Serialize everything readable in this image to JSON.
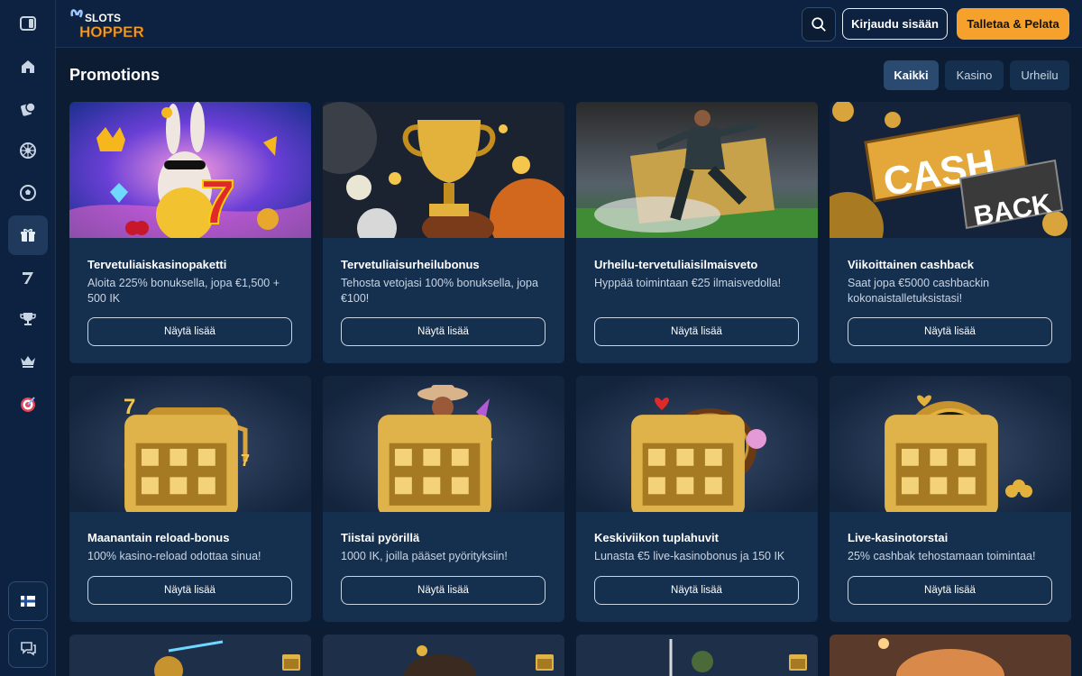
{
  "header": {
    "logo_top": "SLOTS",
    "logo_bottom": "HOPPER",
    "login_label": "Kirjaudu sisään",
    "deposit_label": "Talletaa & Pelata"
  },
  "page": {
    "title": "Promotions"
  },
  "filters": [
    {
      "label": "Kaikki",
      "active": true
    },
    {
      "label": "Kasino",
      "active": false
    },
    {
      "label": "Urheilu",
      "active": false
    }
  ],
  "sidebar": {
    "icons": [
      "toggle-sidebar-icon",
      "home-icon",
      "casino-chip-icon",
      "roulette-icon",
      "sports-ball-icon",
      "gift-icon",
      "lucky-seven-icon",
      "trophy-icon",
      "crown-icon",
      "target-icon"
    ],
    "active": "gift-icon",
    "bottom": [
      "finland-flag-icon",
      "chat-icon"
    ]
  },
  "cards": [
    {
      "title": "Tervetuliaiskasinopaketti",
      "desc": "Aloita 225% bonuksella, jopa €1,500 + 500 IK",
      "button": "Näytä lisää",
      "image": "rabbit-slot-image"
    },
    {
      "title": "Tervetuliaisurheilubonus",
      "desc": "Tehosta vetojasi 100% bonuksella, jopa €100!",
      "button": "Näytä lisää",
      "image": "trophy-cup-image"
    },
    {
      "title": "Urheilu-tervetuliaisilmaisveto",
      "desc": "Hyppää toimintaan €25 ilmaisvedolla!",
      "button": "Näytä lisää",
      "image": "football-player-image"
    },
    {
      "title": "Viikoittainen cashback",
      "desc": "Saat jopa €5000 cashbackin kokonaistalletuksistasi!",
      "button": "Näytä lisää",
      "image": "cashback-sign-image"
    },
    {
      "title": "Maanantain reload-bonus",
      "desc": "100% kasino-reload odottaa sinua!",
      "button": "Näytä lisää",
      "image": "slot-machine-image"
    },
    {
      "title": "Tiistai pyörillä",
      "desc": "1000 IK, joilla pääset pyörityksiin!",
      "button": "Näytä lisää",
      "image": "cowboy-image"
    },
    {
      "title": "Keskiviikon tuplahuvit",
      "desc": "Lunasta €5 live-kasinobonus ja 150 IK",
      "button": "Näytä lisää",
      "image": "roulette-wheel-image"
    },
    {
      "title": "Live-kasinotorstai",
      "desc": "25% cashbak tehostamaan toimintaa!",
      "button": "Näytä lisää",
      "image": "poker-chip-image"
    }
  ],
  "colors": {
    "background": "#0b1c33",
    "card": "#15304f",
    "accent": "#f5a12c"
  }
}
